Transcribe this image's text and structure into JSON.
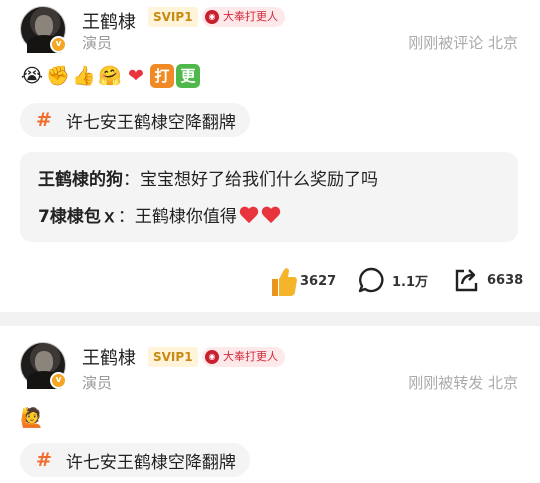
{
  "posts": [
    {
      "username": "王鹤棣",
      "svip": "SVIP1",
      "fan_badge": "大奉打更人",
      "role": "演员",
      "meta": "刚刚被评论 北京",
      "emojis": [
        "crying-face",
        "fist-bump",
        "thumbs-up",
        "hugging",
        "red-heart",
        "da",
        "geng"
      ],
      "emoji_glyphs": [
        "😭",
        "✊",
        "👍",
        "🤗",
        "❤",
        "打",
        "更"
      ],
      "topic": "许七安王鹤棣空降翻牌",
      "comments": [
        {
          "name": "王鹤棣的狗",
          "separator": "：",
          "text": "宝宝想好了给我们什么奖励了吗"
        },
        {
          "name": "7棣棣包ｘ",
          "separator": "：",
          "text": "王鹤棣你值得"
        }
      ],
      "actions": {
        "likes": "3627",
        "comments": "1.1万",
        "reposts": "6638"
      }
    },
    {
      "username": "王鹤棣",
      "svip": "SVIP1",
      "fan_badge": "大奉打更人",
      "role": "演员",
      "meta": "刚刚被转发 北京",
      "emoji_glyphs": [
        "🙋"
      ],
      "topic": "许七安王鹤棣空降翻牌"
    }
  ],
  "colors": {
    "accent_orange": "#f06d2d",
    "svip_gold": "#c98a12",
    "heart_red": "#e8343c",
    "like_yellow": "#f5a623"
  }
}
